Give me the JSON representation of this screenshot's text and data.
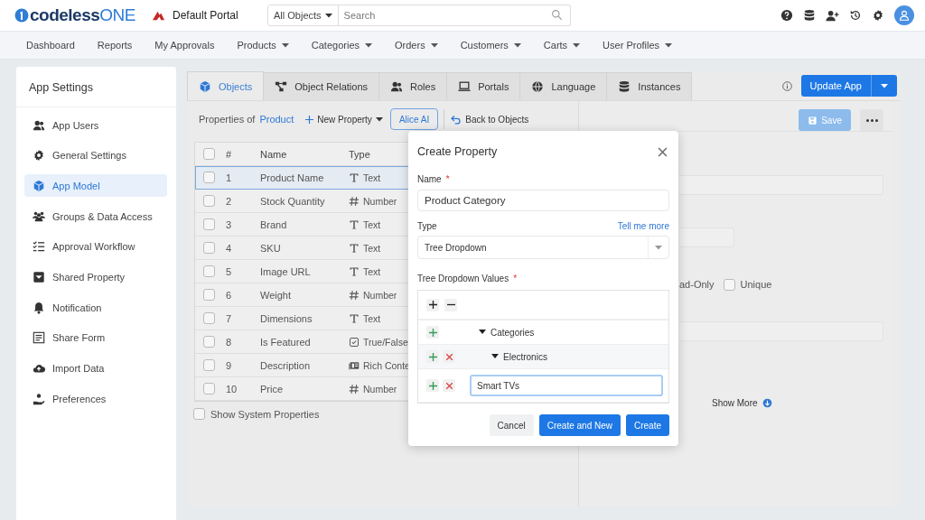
{
  "header": {
    "logo_main": "codeless",
    "logo_accent": "ONE",
    "portal": "Default Portal",
    "search_scope": "All Objects",
    "search_placeholder": "Search"
  },
  "nav": [
    {
      "label": "Dashboard",
      "dropdown": false
    },
    {
      "label": "Reports",
      "dropdown": false
    },
    {
      "label": "My Approvals",
      "dropdown": false
    },
    {
      "label": "Products",
      "dropdown": true
    },
    {
      "label": "Categories",
      "dropdown": true
    },
    {
      "label": "Orders",
      "dropdown": true
    },
    {
      "label": "Customers",
      "dropdown": true
    },
    {
      "label": "Carts",
      "dropdown": true
    },
    {
      "label": "User Profiles",
      "dropdown": true
    }
  ],
  "sidebar": {
    "title": "App Settings",
    "items": [
      {
        "label": "App Users",
        "kind": "users",
        "selected": false
      },
      {
        "label": "General Settings",
        "kind": "gear",
        "selected": false
      },
      {
        "label": "App Model",
        "kind": "cube",
        "selected": true
      },
      {
        "label": "Groups & Data Access",
        "kind": "group",
        "selected": false
      },
      {
        "label": "Approval Workflow",
        "kind": "checklist",
        "selected": false
      },
      {
        "label": "Shared Property",
        "kind": "inbox",
        "selected": false
      },
      {
        "label": "Notification",
        "kind": "bell",
        "selected": false
      },
      {
        "label": "Share Form",
        "kind": "form",
        "selected": false
      },
      {
        "label": "Import Data",
        "kind": "cloud",
        "selected": false
      },
      {
        "label": "Preferences",
        "kind": "hand",
        "selected": false
      }
    ]
  },
  "tabs": [
    {
      "label": "Objects",
      "kind": "cube",
      "selected": true
    },
    {
      "label": "Object Relations",
      "kind": "relations",
      "selected": false
    },
    {
      "label": "Roles",
      "kind": "users",
      "selected": false
    },
    {
      "label": "Portals",
      "kind": "laptop",
      "selected": false
    },
    {
      "label": "Language",
      "kind": "globe",
      "selected": false
    },
    {
      "label": "Instances",
      "kind": "database",
      "selected": false
    }
  ],
  "update_button": "Update App",
  "toolbar": {
    "prefix": "Properties of",
    "object": "Product",
    "new_property": "New Property",
    "ai_button": "Alice AI",
    "back": "Back to Objects"
  },
  "table": {
    "select_all_checked": false,
    "columns": [
      "#",
      "Name",
      "Type"
    ],
    "rows": [
      {
        "index": "1",
        "name": "Product Name",
        "type": "Text",
        "kind": "text",
        "selected": true,
        "checked": false
      },
      {
        "index": "2",
        "name": "Stock Quantity",
        "type": "Number",
        "kind": "number",
        "selected": false,
        "checked": false
      },
      {
        "index": "3",
        "name": "Brand",
        "type": "Text",
        "kind": "text",
        "selected": false,
        "checked": false
      },
      {
        "index": "4",
        "name": "SKU",
        "type": "Text",
        "kind": "text",
        "selected": false,
        "checked": false
      },
      {
        "index": "5",
        "name": "Image URL",
        "type": "Text",
        "kind": "text",
        "selected": false,
        "checked": false
      },
      {
        "index": "6",
        "name": "Weight",
        "type": "Number",
        "kind": "number",
        "selected": false,
        "checked": false
      },
      {
        "index": "7",
        "name": "Dimensions",
        "type": "Text",
        "kind": "text",
        "selected": false,
        "checked": false
      },
      {
        "index": "8",
        "name": "Is Featured",
        "type": "True/False",
        "kind": "boolean",
        "selected": false,
        "checked": false
      },
      {
        "index": "9",
        "name": "Description",
        "type": "Rich Conte",
        "kind": "rich",
        "selected": false,
        "checked": false
      },
      {
        "index": "10",
        "name": "Price",
        "type": "Number",
        "kind": "number",
        "selected": false,
        "checked": false
      }
    ]
  },
  "show_system": {
    "label": "Show System Properties",
    "checked": false
  },
  "detail": {
    "save": "Save",
    "read_only_label": "ad-Only",
    "unique": {
      "label": "Unique",
      "checked": false
    },
    "show_more": "Show More"
  },
  "modal": {
    "title": "Create Property",
    "name_label": "Name",
    "name_required": "*",
    "name_value": "Product Category",
    "type_label": "Type",
    "help_link": "Tell me more",
    "type_value": "Tree Dropdown",
    "tree_label": "Tree Dropdown Values",
    "tree_required": "*",
    "tree": [
      {
        "label": "Categories",
        "expanded": true,
        "removable": false,
        "editing": false,
        "children": [
          {
            "label": "Electronics",
            "expanded": true,
            "removable": true,
            "editing": false,
            "children": [
              {
                "label": "Smart TVs",
                "removable": true,
                "editing": true
              }
            ]
          }
        ]
      }
    ],
    "buttons": [
      {
        "label": "Cancel",
        "kind": "secondary"
      },
      {
        "label": "Create and New",
        "kind": "primary"
      },
      {
        "label": "Create",
        "kind": "primary"
      }
    ]
  }
}
